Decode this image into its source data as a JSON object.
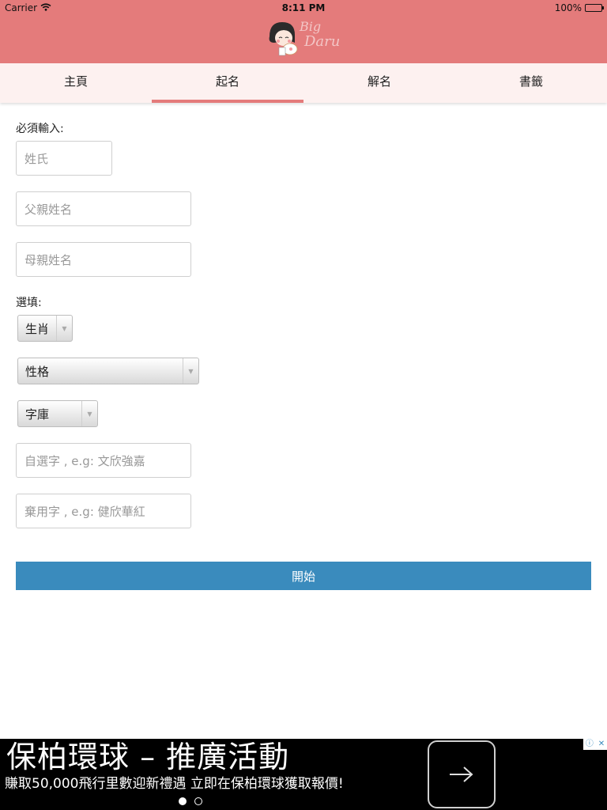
{
  "status_bar": {
    "carrier": "Carrier",
    "time": "8:11 PM",
    "battery": "100%"
  },
  "header": {
    "logo_line1": "Big",
    "logo_line2": "Daru"
  },
  "tabs": [
    {
      "label": "主頁",
      "active": false
    },
    {
      "label": "起名",
      "active": true
    },
    {
      "label": "解名",
      "active": false
    },
    {
      "label": "書籤",
      "active": false
    }
  ],
  "form": {
    "required_label": "必須輸入:",
    "surname_placeholder": "姓氏",
    "father_name_placeholder": "父親姓名",
    "mother_name_placeholder": "母親姓名",
    "optional_label": "選填:",
    "zodiac_select": "生肖",
    "personality_select": "性格",
    "dictionary_select": "字庫",
    "chosen_chars_placeholder": "自選字 , e.g: 文欣強嘉",
    "excluded_chars_placeholder": "棄用字 , e.g: 健欣華紅",
    "start_button": "開始"
  },
  "ad": {
    "headline": "保柏環球 – 推廣活動",
    "subtext": "賺取50,000飛行里數迎新禮遇 立即在保柏環球獲取報價!",
    "info_icon": "ⓘ",
    "close_icon": "✕",
    "page_indicator": {
      "count": 2,
      "active_index": 0
    }
  },
  "colors": {
    "header": "#e47b7b",
    "tabbar": "#fdf1f0",
    "accent": "#3a8bbd"
  }
}
